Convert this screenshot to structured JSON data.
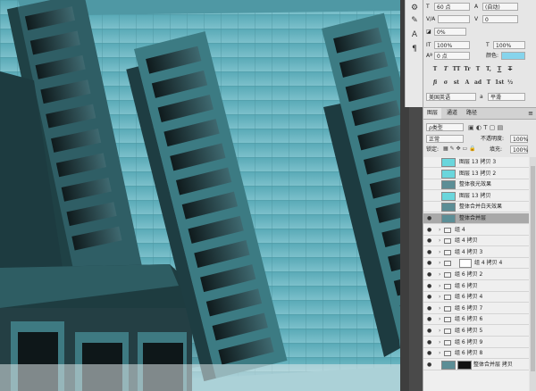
{
  "character": {
    "font_size": "60 点",
    "leading": "(自动)",
    "kerning": "V/A",
    "tracking": "0",
    "baseline_shift_pct": "0%",
    "vscale": "100%",
    "hscale": "100%",
    "baseline_shift": "0 点",
    "color_label": "颜色:",
    "color": "#86d4ec",
    "style_buttons": [
      "T",
      "T",
      "TT",
      "Tr",
      "T",
      "T,",
      "T",
      "T"
    ],
    "ot_buttons": [
      "fi",
      "σ",
      "st",
      "A",
      "ad",
      "T",
      "1st",
      "½"
    ],
    "language": "美国英语",
    "aa_label": "a",
    "antialias": "平滑"
  },
  "tabs": [
    "图层",
    "通道",
    "路径"
  ],
  "layers_panel": {
    "kind": "ρ类型",
    "blend": "正常",
    "opacity_label": "不透明度:",
    "opacity": "100%",
    "lock_label": "锁定:",
    "fill_label": "填充:",
    "fill": "100%"
  },
  "layers": [
    {
      "name": "图层 13 拷贝 3",
      "type": "fill",
      "visible": false,
      "selected": false
    },
    {
      "name": "图层 13 拷贝 2",
      "type": "fill",
      "visible": false,
      "selected": false
    },
    {
      "name": "整体夜光效果",
      "type": "image",
      "visible": false,
      "selected": false
    },
    {
      "name": "图层 13 拷贝",
      "type": "fill",
      "visible": false,
      "selected": false
    },
    {
      "name": "整体合并白天效果",
      "type": "image",
      "visible": false,
      "selected": false
    },
    {
      "name": "整体合并层",
      "type": "image",
      "visible": true,
      "selected": true
    },
    {
      "name": "组 4",
      "type": "group",
      "visible": true,
      "selected": false
    },
    {
      "name": "组 4 拷贝",
      "type": "group",
      "visible": true,
      "selected": false
    },
    {
      "name": "组 4 拷贝 3",
      "type": "group",
      "visible": true,
      "selected": false
    },
    {
      "name": "组 4 拷贝 4",
      "type": "group-mask",
      "visible": true,
      "selected": false
    },
    {
      "name": "组 6 拷贝 2",
      "type": "group",
      "visible": true,
      "selected": false
    },
    {
      "name": "组 6 拷贝",
      "type": "group",
      "visible": true,
      "selected": false
    },
    {
      "name": "组 6 拷贝 4",
      "type": "group",
      "visible": true,
      "selected": false
    },
    {
      "name": "组 6 拷贝 7",
      "type": "group",
      "visible": true,
      "selected": false
    },
    {
      "name": "组 6 拷贝 6",
      "type": "group",
      "visible": true,
      "selected": false
    },
    {
      "name": "组 6 拷贝 5",
      "type": "group",
      "visible": true,
      "selected": false
    },
    {
      "name": "组 6 拷贝 9",
      "type": "group",
      "visible": true,
      "selected": false
    },
    {
      "name": "组 6 拷贝 8",
      "type": "group",
      "visible": true,
      "selected": false
    },
    {
      "name": "整体合并层 拷贝",
      "type": "image-mask",
      "visible": true,
      "selected": false
    }
  ]
}
